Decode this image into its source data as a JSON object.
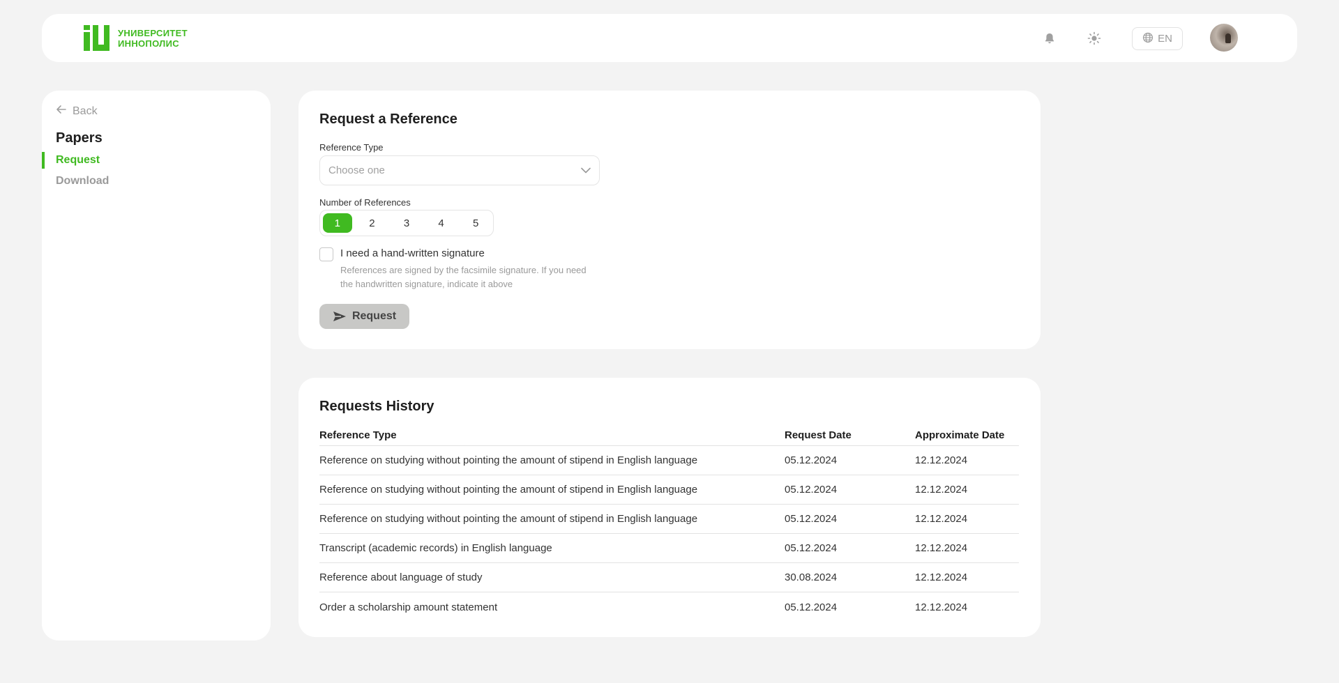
{
  "header": {
    "logo_line1": "УНИВЕРСИТЕТ",
    "logo_line2": "ИННОПОЛИС",
    "language": "EN",
    "icons": [
      "bell-icon",
      "sun-icon",
      "globe-icon"
    ]
  },
  "sidebar": {
    "back_label": "Back",
    "section_title": "Papers",
    "items": [
      {
        "label": "Request",
        "active": true
      },
      {
        "label": "Download",
        "active": false
      }
    ]
  },
  "request_form": {
    "title": "Request a Reference",
    "type_label": "Reference Type",
    "type_placeholder": "Choose one",
    "number_label": "Number of References",
    "numbers": [
      "1",
      "2",
      "3",
      "4",
      "5"
    ],
    "selected_number": "1",
    "signature_label": "I need a hand-written signature",
    "signature_hint": "References are signed by the facsimile signature. If you need the handwritten signature, indicate it above",
    "signature_checked": false,
    "submit_label": "Request"
  },
  "history": {
    "title": "Requests History",
    "columns": [
      "Reference Type",
      "Request Date",
      "Approximate Date"
    ],
    "rows": [
      {
        "type": "Reference on studying without pointing the amount of stipend in English language",
        "request_date": "05.12.2024",
        "approx_date": "12.12.2024"
      },
      {
        "type": "Reference on studying without pointing the amount of stipend in English language",
        "request_date": "05.12.2024",
        "approx_date": "12.12.2024"
      },
      {
        "type": "Reference on studying without pointing the amount of stipend in English language",
        "request_date": "05.12.2024",
        "approx_date": "12.12.2024"
      },
      {
        "type": "Transcript (academic records) in English language",
        "request_date": "05.12.2024",
        "approx_date": "12.12.2024"
      },
      {
        "type": "Reference about language of study",
        "request_date": "30.08.2024",
        "approx_date": "12.12.2024"
      },
      {
        "type": "Order a scholarship amount statement",
        "request_date": "05.12.2024",
        "approx_date": "12.12.2024"
      }
    ]
  },
  "colors": {
    "accent": "#40ba21",
    "background": "#f3f3f3",
    "card": "#ffffff",
    "button_disabled": "#c8c8c6"
  }
}
